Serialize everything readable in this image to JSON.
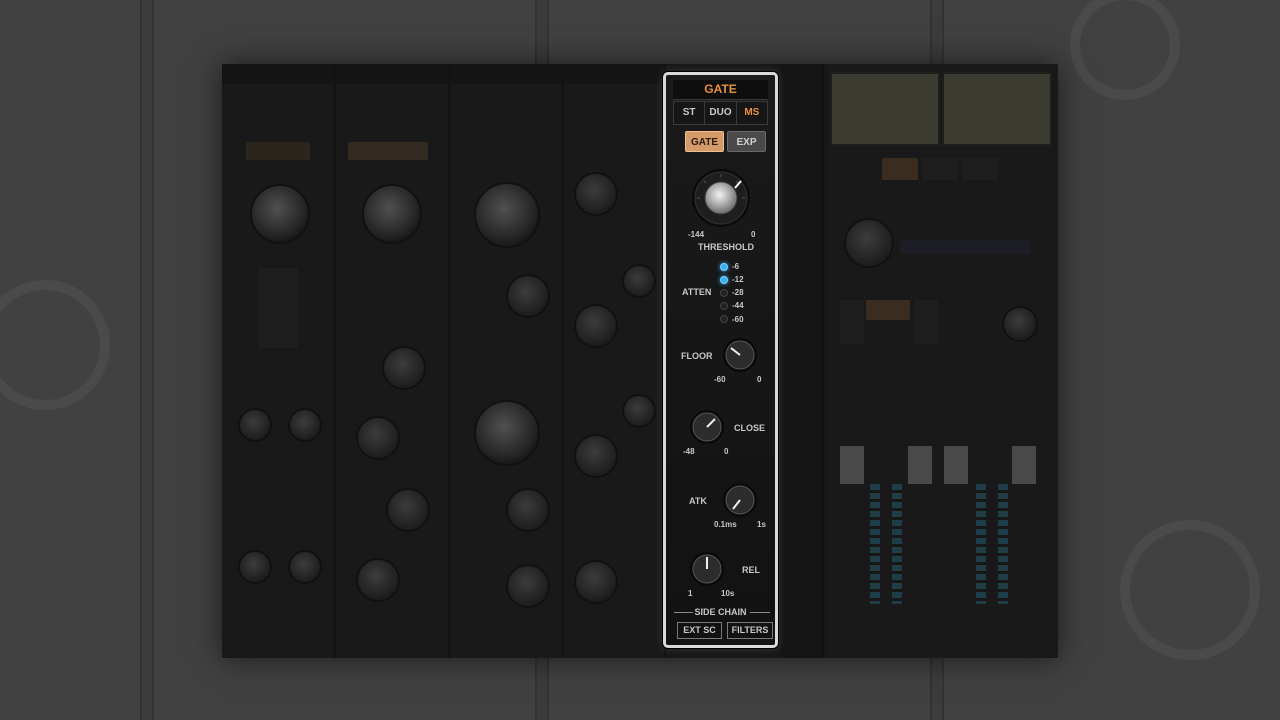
{
  "gate": {
    "title": "GATE",
    "modes": [
      {
        "label": "ST",
        "active": false
      },
      {
        "label": "DUO",
        "active": false
      },
      {
        "label": "MS",
        "active": true
      }
    ],
    "types": [
      {
        "label": "GATE",
        "active": true
      },
      {
        "label": "EXP",
        "active": false
      }
    ],
    "threshold": {
      "label": "THRESHOLD",
      "min": "-144",
      "max": "0"
    },
    "atten": {
      "label": "ATTEN",
      "steps": [
        {
          "label": "-6",
          "lit": true
        },
        {
          "label": "-12",
          "lit": true
        },
        {
          "label": "-28",
          "lit": false
        },
        {
          "label": "-44",
          "lit": false
        },
        {
          "label": "-60",
          "lit": false
        }
      ]
    },
    "floor": {
      "label": "FLOOR",
      "min": "-60",
      "max": "0"
    },
    "close": {
      "label": "CLOSE",
      "min": "-48",
      "max": "0"
    },
    "atk": {
      "label": "ATK",
      "min": "0.1ms",
      "max": "1s"
    },
    "rel": {
      "label": "REL",
      "min": "1",
      "max": "10s"
    },
    "side_chain": {
      "title": "SIDE CHAIN",
      "ext_sc": "EXT SC",
      "filters": "FILTERS"
    }
  },
  "colors": {
    "accent": "#e8913e",
    "led": "#3ab0f0",
    "highlight_border": "#d9d9d9"
  },
  "icons": [
    "threshold-knob-icon",
    "floor-knob-icon",
    "close-knob-icon",
    "atk-knob-icon",
    "rel-knob-icon"
  ]
}
